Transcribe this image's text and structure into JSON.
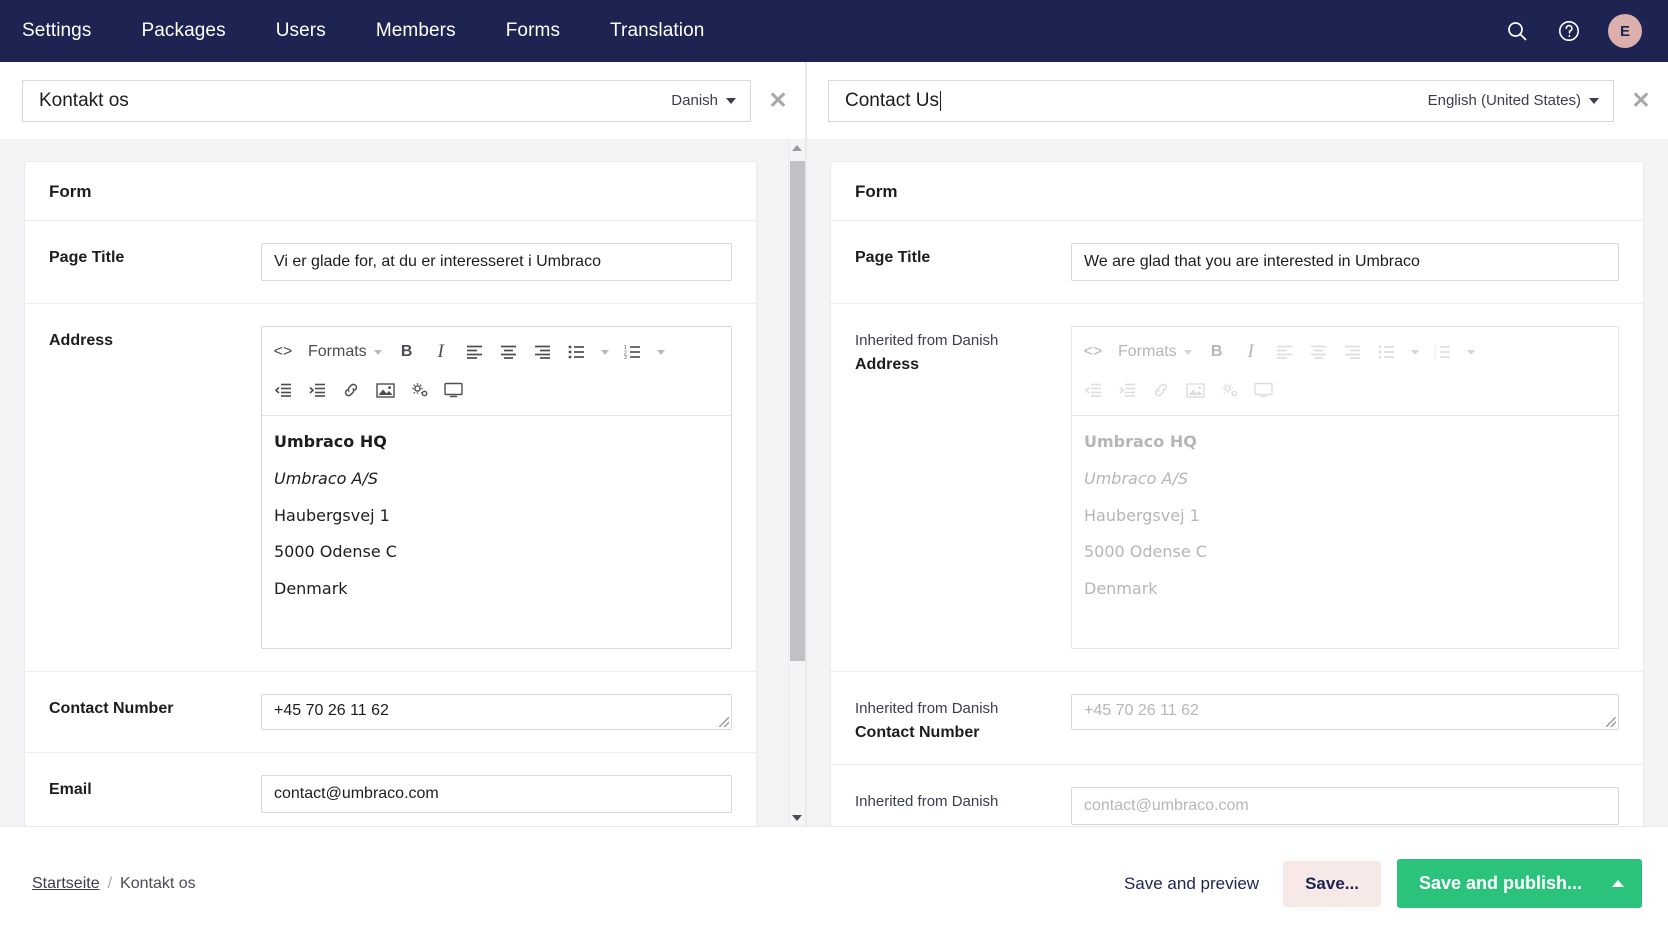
{
  "topnav": {
    "items": [
      {
        "label": "Settings",
        "name": "nav-item-settings"
      },
      {
        "label": "Packages",
        "name": "nav-item-packages"
      },
      {
        "label": "Users",
        "name": "nav-item-users"
      },
      {
        "label": "Members",
        "name": "nav-item-members"
      },
      {
        "label": "Forms",
        "name": "nav-item-forms"
      },
      {
        "label": "Translation",
        "name": "nav-item-translation"
      }
    ],
    "icons": {
      "search": "search-icon",
      "help": "help-icon"
    },
    "avatar_initial": "E",
    "colors": {
      "bar_background": "#1d2452",
      "avatar_background": "#dbb0ac",
      "text": "#ffffff"
    }
  },
  "panes": {
    "left": {
      "title_value": "Kontakt os",
      "language": "Danish",
      "close_label": "✕",
      "card_title": "Form",
      "fields": {
        "page_title": {
          "label": "Page Title",
          "value": "Vi er glade for, at du er interesseret i Umbraco"
        },
        "address": {
          "label": "Address",
          "formats_label": "Formats",
          "content": [
            {
              "text": "Umbraco HQ",
              "style": "bold"
            },
            {
              "text": "Umbraco A/S",
              "style": "italic"
            },
            {
              "text": "Haubergsvej 1",
              "style": "normal"
            },
            {
              "text": "5000 Odense C",
              "style": "normal"
            },
            {
              "text": "Denmark",
              "style": "normal"
            }
          ]
        },
        "contact_number": {
          "label": "Contact Number",
          "value": "+45 70 26 11 62"
        },
        "email": {
          "label": "Email",
          "value": "contact@umbraco.com"
        }
      }
    },
    "right": {
      "title_value": "Contact Us",
      "language": "English (United States)",
      "close_label": "✕",
      "card_title": "Form",
      "fields": {
        "page_title": {
          "label": "Page Title",
          "value": "We are glad that you are interested in Umbraco"
        },
        "address": {
          "inherit_note": "Inherited from Danish",
          "label": "Address",
          "formats_label": "Formats",
          "content": [
            {
              "text": "Umbraco HQ",
              "style": "bold"
            },
            {
              "text": "Umbraco A/S",
              "style": "italic"
            },
            {
              "text": "Haubergsvej 1",
              "style": "normal"
            },
            {
              "text": "5000 Odense C",
              "style": "normal"
            },
            {
              "text": "Denmark",
              "style": "normal"
            }
          ]
        },
        "contact_number": {
          "inherit_note": "Inherited from Danish",
          "label": "Contact Number",
          "value": "+45 70 26 11 62"
        },
        "email": {
          "inherit_note": "Inherited from Danish",
          "value": "contact@umbraco.com"
        }
      }
    }
  },
  "footer": {
    "breadcrumb": {
      "root": "Startseite",
      "separator": "/",
      "current": "Kontakt os"
    },
    "save_and_preview": "Save and preview",
    "save": "Save...",
    "save_and_publish": "Save and publish...",
    "colors": {
      "primary": "#2bc37c",
      "soft": "#f6e9e7"
    }
  },
  "editor_toolbar": {
    "source_code": "<>",
    "bold": "B",
    "italic": "I"
  }
}
